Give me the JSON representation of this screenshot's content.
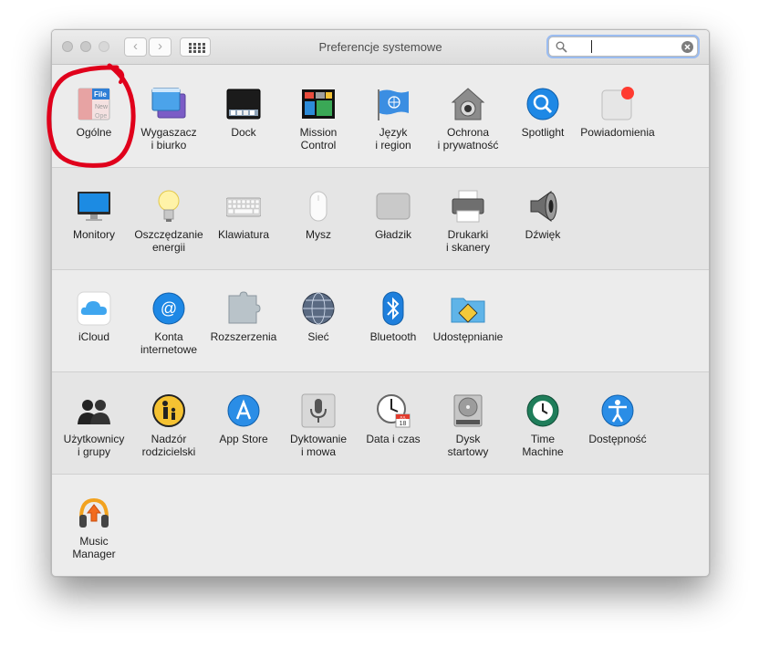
{
  "window": {
    "title": "Preferencje systemowe",
    "search": {
      "value": "",
      "placeholder": ""
    }
  },
  "sections": [
    {
      "items": [
        {
          "id": "general",
          "label": "Ogólne",
          "icon": "general-icon",
          "icon_text": [
            "File",
            "New",
            "Ope"
          ]
        },
        {
          "id": "desktop",
          "label": "Wygaszacz\ni biurko",
          "icon": "desktop-screensaver-icon"
        },
        {
          "id": "dock",
          "label": "Dock",
          "icon": "dock-icon"
        },
        {
          "id": "mission",
          "label": "Mission\nControl",
          "icon": "mission-control-icon"
        },
        {
          "id": "language",
          "label": "Język\ni region",
          "icon": "language-region-flag-icon"
        },
        {
          "id": "security",
          "label": "Ochrona\ni prywatność",
          "icon": "security-privacy-icon"
        },
        {
          "id": "spotlight",
          "label": "Spotlight",
          "icon": "spotlight-icon"
        },
        {
          "id": "notifications",
          "label": "Powiadomienia",
          "icon": "notifications-icon"
        }
      ]
    },
    {
      "items": [
        {
          "id": "displays",
          "label": "Monitory",
          "icon": "displays-icon"
        },
        {
          "id": "energy",
          "label": "Oszczędzanie\nenergii",
          "icon": "energy-saver-bulb-icon"
        },
        {
          "id": "keyboard",
          "label": "Klawiatura",
          "icon": "keyboard-icon"
        },
        {
          "id": "mouse",
          "label": "Mysz",
          "icon": "mouse-icon"
        },
        {
          "id": "trackpad",
          "label": "Gładzik",
          "icon": "trackpad-icon"
        },
        {
          "id": "printers",
          "label": "Drukarki\ni skanery",
          "icon": "printer-icon"
        },
        {
          "id": "sound",
          "label": "Dźwięk",
          "icon": "speaker-icon"
        }
      ]
    },
    {
      "items": [
        {
          "id": "icloud",
          "label": "iCloud",
          "icon": "icloud-icon"
        },
        {
          "id": "internet",
          "label": "Konta\ninternetowe",
          "icon": "internet-accounts-icon"
        },
        {
          "id": "extensions",
          "label": "Rozszerzenia",
          "icon": "extensions-puzzle-icon"
        },
        {
          "id": "network",
          "label": "Sieć",
          "icon": "network-globe-icon"
        },
        {
          "id": "bluetooth",
          "label": "Bluetooth",
          "icon": "bluetooth-icon"
        },
        {
          "id": "sharing",
          "label": "Udostępnianie",
          "icon": "sharing-folder-icon"
        }
      ]
    },
    {
      "items": [
        {
          "id": "users",
          "label": "Użytkownicy\ni grupy",
          "icon": "users-groups-icon"
        },
        {
          "id": "parental",
          "label": "Nadzór\nrodzicielski",
          "icon": "parental-controls-icon"
        },
        {
          "id": "appstore",
          "label": "App Store",
          "icon": "app-store-icon"
        },
        {
          "id": "dictation",
          "label": "Dyktowanie\ni mowa",
          "icon": "dictation-microphone-icon"
        },
        {
          "id": "datetime",
          "label": "Data i czas",
          "icon": "date-time-clock-icon",
          "icon_text": [
            "JUL",
            "18"
          ]
        },
        {
          "id": "startup",
          "label": "Dysk\nstartowy",
          "icon": "startup-disk-icon"
        },
        {
          "id": "timemachine",
          "label": "Time\nMachine",
          "icon": "time-machine-icon"
        },
        {
          "id": "accessibility",
          "label": "Dostępność",
          "icon": "accessibility-icon"
        }
      ]
    },
    {
      "items": [
        {
          "id": "musicmanager",
          "label": "Music\nManager",
          "icon": "music-manager-headphones-icon"
        }
      ]
    }
  ],
  "colors": {
    "accent": "#1e88e5",
    "annotation": "#e0001b",
    "badge": "#ff3b30"
  }
}
